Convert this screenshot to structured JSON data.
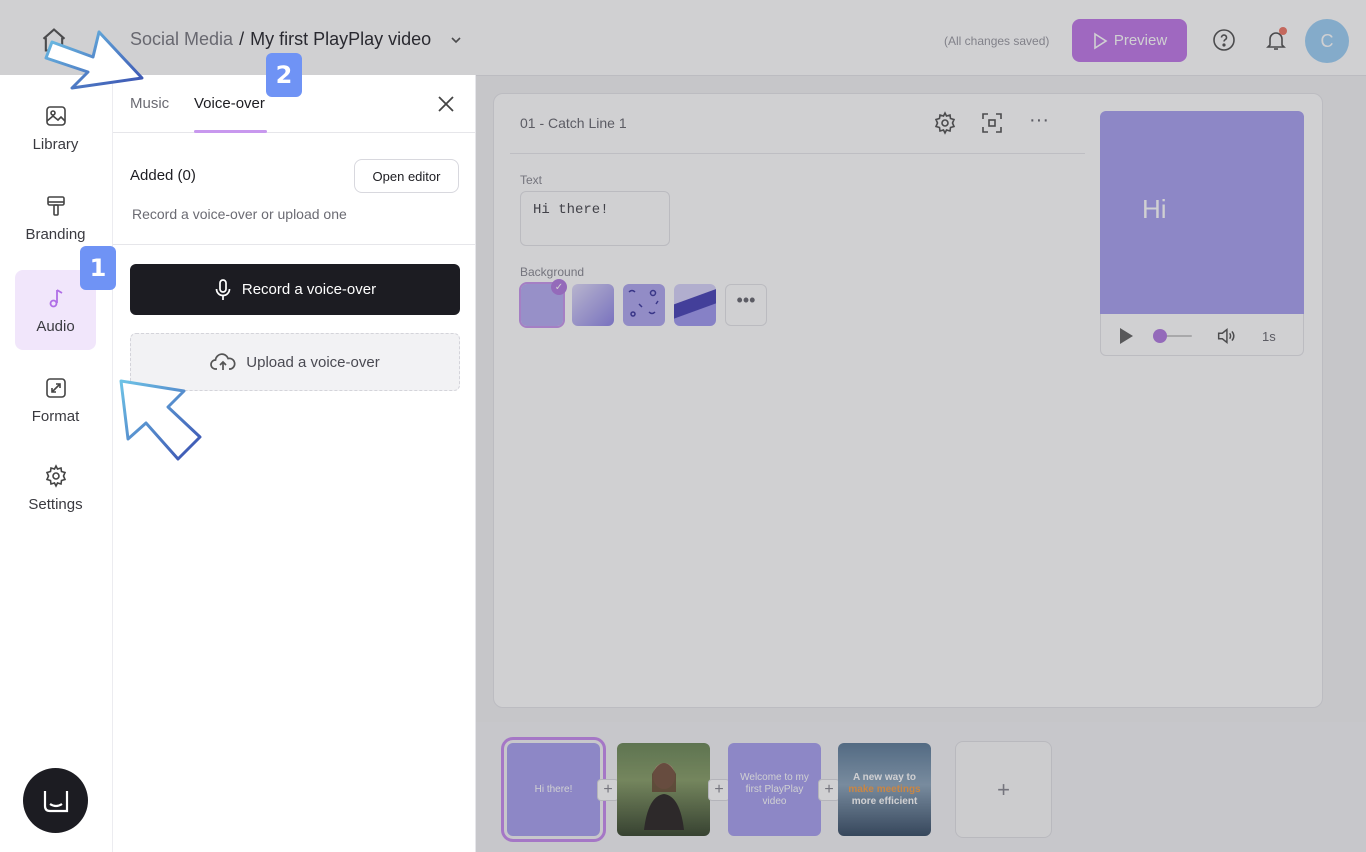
{
  "topbar": {
    "breadcrumb_parent": "Social Media",
    "breadcrumb_separator": " / ",
    "breadcrumb_current": "My first PlayPlay video",
    "saved_status": "(All changes saved)",
    "preview_label": "Preview",
    "avatar_initial": "C"
  },
  "sidebar": {
    "items": [
      {
        "label": "Library",
        "icon": "image-icon"
      },
      {
        "label": "Branding",
        "icon": "paint-roller-icon"
      },
      {
        "label": "Audio",
        "icon": "music-note-icon",
        "active": true
      },
      {
        "label": "Format",
        "icon": "resize-icon"
      },
      {
        "label": "Settings",
        "icon": "gear-icon"
      }
    ]
  },
  "panel": {
    "tabs": [
      {
        "label": "Music"
      },
      {
        "label": "Voice-over",
        "active": true
      }
    ],
    "added_label": "Added (0)",
    "open_editor_label": "Open editor",
    "hint": "Record a voice-over or upload one",
    "record_label": "Record a voice-over",
    "upload_label": "Upload a voice-over"
  },
  "scene": {
    "title": "01 - Catch Line 1",
    "text_label": "Text",
    "text_value": "Hi there!",
    "background_label": "Background",
    "more_label": "•••"
  },
  "preview": {
    "text": "Hi",
    "duration": "1s"
  },
  "timeline": {
    "thumbs": [
      {
        "text": "Hi there!",
        "selected": true
      },
      {
        "text": ""
      },
      {
        "text": "Welcome to my first PlayPlay video"
      },
      {
        "text_before": "A new way to ",
        "text_highlight": "make meetings",
        "text_after": " more efficient"
      }
    ],
    "plus": "+",
    "add_label": "+"
  },
  "annotations": {
    "step1": "1",
    "step2": "2"
  },
  "colors": {
    "accent": "#c07ae8",
    "active_bg": "#f1e6fb",
    "badge": "#6f93f5",
    "dark_button": "#1c1c22"
  }
}
